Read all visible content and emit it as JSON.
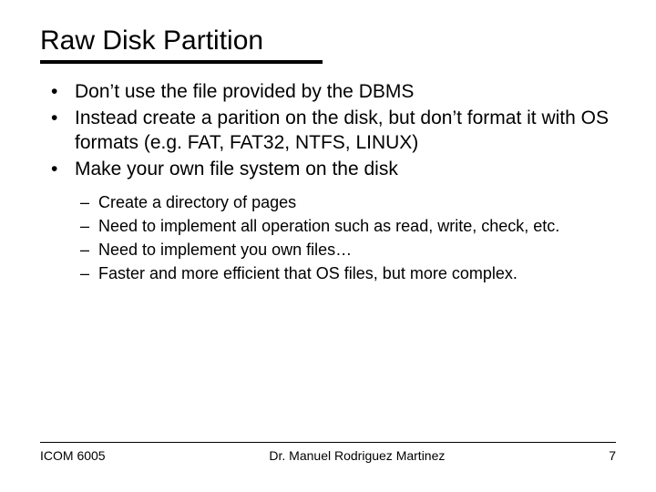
{
  "title": "Raw Disk Partition",
  "bullets": {
    "b0": "Don’t use the file provided by the DBMS",
    "b1": "Instead create a parition on the disk, but don’t format it with OS formats (e.g. FAT, FAT32, NTFS, LINUX)",
    "b2": "Make your own file system on the disk"
  },
  "sub": {
    "s0": "Create a directory of pages",
    "s1": "Need to implement all operation such as read, write, check, etc.",
    "s2": "Need to implement you own files…",
    "s3": "Faster and more efficient that OS files, but more complex."
  },
  "footer": {
    "left": "ICOM 6005",
    "center": "Dr. Manuel Rodriguez Martinez",
    "page": "7"
  }
}
